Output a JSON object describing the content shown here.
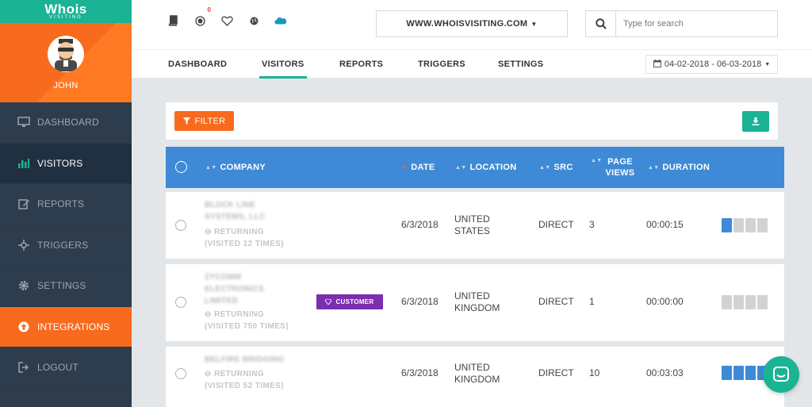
{
  "brand": {
    "logo": "Whois",
    "logo_sub": "VISITING"
  },
  "profile": {
    "name": "JOHN"
  },
  "sidebar": {
    "items": [
      {
        "label": "DASHBOARD",
        "icon": "monitor-icon"
      },
      {
        "label": "VISITORS",
        "icon": "bar-chart-icon"
      },
      {
        "label": "REPORTS",
        "icon": "edit-icon"
      },
      {
        "label": "TRIGGERS",
        "icon": "crosshair-icon"
      },
      {
        "label": "SETTINGS",
        "icon": "gear-icon"
      },
      {
        "label": "INTEGRATIONS",
        "icon": "arrow-up-circle-icon"
      },
      {
        "label": "LOGOUT",
        "icon": "logout-icon"
      }
    ]
  },
  "topbar": {
    "notification_count": "0",
    "site_select": "WWW.WHOISVISITING.COM",
    "search_placeholder": "Type for search"
  },
  "tabs": [
    "DASHBOARD",
    "VISITORS",
    "REPORTS",
    "TRIGGERS",
    "SETTINGS"
  ],
  "date_range": "04-02-2018 - 06-03-2018",
  "filter_label": "FILTER",
  "table": {
    "columns": {
      "company": "COMPANY",
      "date": "DATE",
      "location": "LOCATION",
      "src": "SRC",
      "page_views_1": "PAGE",
      "page_views_2": "VIEWS",
      "duration": "DURATION"
    },
    "rows": [
      {
        "company_line1": "BLOCK LINE",
        "company_line2": "SYSTEMS, LLC",
        "company_line3": "",
        "status": "RETURNING",
        "visits": "(VISITED 12 TIMES)",
        "tag": "",
        "date": "6/3/2018",
        "location_line1": "UNITED",
        "location_line2": "STATES",
        "src": "DIRECT",
        "page_views": "3",
        "duration": "00:00:15",
        "engagement": 1
      },
      {
        "company_line1": "ZYCOMM",
        "company_line2": "ELECTRONICS",
        "company_line3": "LIMITED",
        "status": "RETURNING",
        "visits": "(VISITED 750 TIMES)",
        "tag": "CUSTOMER",
        "date": "6/3/2018",
        "location_line1": "UNITED",
        "location_line2": "KINGDOM",
        "src": "DIRECT",
        "page_views": "1",
        "duration": "00:00:00",
        "engagement": 0
      },
      {
        "company_line1": "BELFIRE BRIDGING",
        "company_line2": "",
        "company_line3": "",
        "status": "RETURNING",
        "visits": "(VISITED 52 TIMES)",
        "tag": "",
        "date": "6/3/2018",
        "location_line1": "UNITED",
        "location_line2": "KINGDOM",
        "src": "DIRECT",
        "page_views": "10",
        "duration": "00:03:03",
        "engagement": 4
      }
    ]
  },
  "colors": {
    "accent_green": "#1ab394",
    "accent_orange": "#f86a1d",
    "table_header_blue": "#3e8ad6",
    "customer_purple": "#7b2fae",
    "sidebar_bg": "#2e3d4d"
  }
}
